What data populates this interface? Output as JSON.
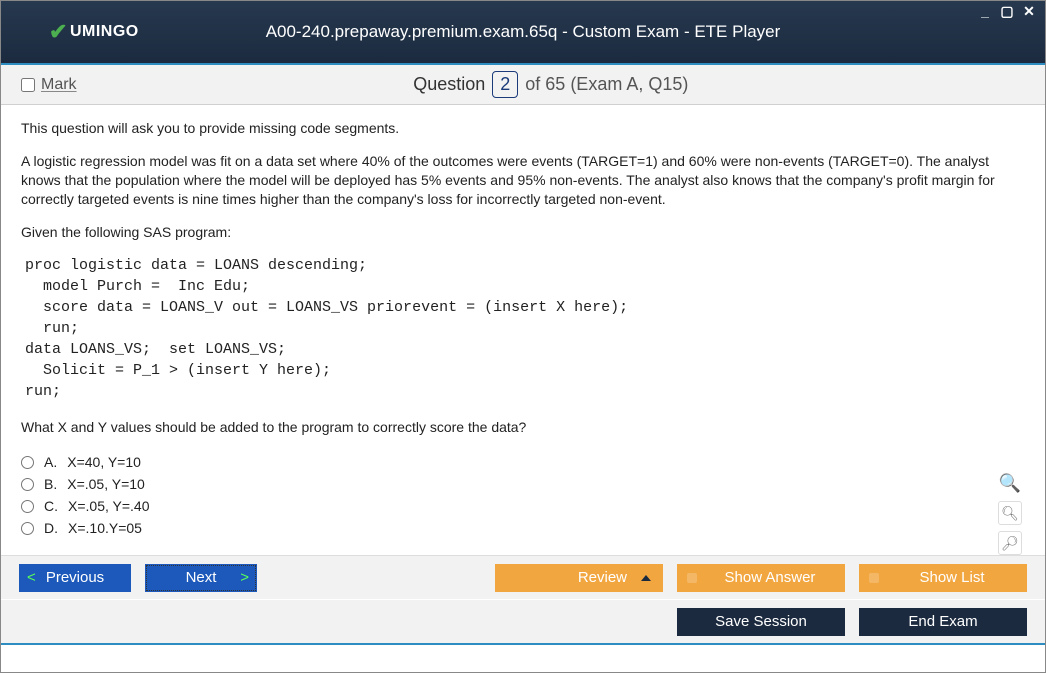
{
  "titlebar": {
    "logo_text": "UMINGO",
    "title": "A00-240.prepaway.premium.exam.65q - Custom Exam - ETE Player"
  },
  "infobar": {
    "mark_label": "Mark",
    "question_label": "Question",
    "question_num": "2",
    "of_text": "of 65 (Exam A, Q15)"
  },
  "question": {
    "intro": "This question will ask you to provide missing code segments.",
    "body": "A logistic regression model was fit on a data set where 40% of the outcomes were events (TARGET=1) and 60% were non-events (TARGET=0). The analyst knows that the population where the model will be deployed has 5% events and 95% non-events. The analyst also knows that the company's profit margin for correctly targeted events is nine times higher than the company's loss for incorrectly targeted non-event.",
    "given": "Given the following SAS program:",
    "code": "proc logistic data = LOANS descending;\n  model Purch =  Inc Edu;\n  score data = LOANS_V out = LOANS_VS priorevent = (insert X here);\n  run;\ndata LOANS_VS;  set LOANS_VS;\n  Solicit = P_1 > (insert Y here);\nrun;",
    "prompt": "What X and Y values should be added to the program to correctly score the data?",
    "options": [
      {
        "letter": "A.",
        "text": "X=40, Y=10"
      },
      {
        "letter": "B.",
        "text": "X=.05, Y=10"
      },
      {
        "letter": "C.",
        "text": "X=.05, Y=.40"
      },
      {
        "letter": "D.",
        "text": "X=.10.Y=05"
      }
    ]
  },
  "buttons": {
    "previous": "Previous",
    "next": "Next",
    "review": "Review",
    "show_answer": "Show Answer",
    "show_list": "Show List",
    "save_session": "Save Session",
    "end_exam": "End Exam"
  }
}
